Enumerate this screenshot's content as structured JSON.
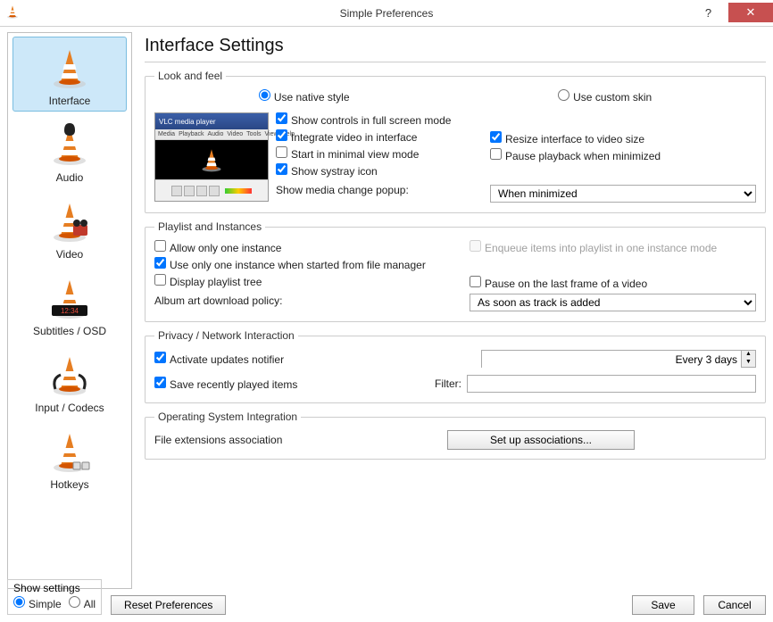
{
  "window": {
    "title": "Simple Preferences"
  },
  "sidebar": {
    "items": [
      {
        "label": "Interface"
      },
      {
        "label": "Audio"
      },
      {
        "label": "Video"
      },
      {
        "label": "Subtitles / OSD"
      },
      {
        "label": "Input / Codecs"
      },
      {
        "label": "Hotkeys"
      }
    ]
  },
  "main": {
    "heading": "Interface Settings",
    "look": {
      "legend": "Look and feel",
      "native": "Use native style",
      "custom": "Use custom skin",
      "show_controls": "Show controls in full screen mode",
      "integrate_video": "Integrate video in interface",
      "resize_interface": "Resize interface to video size",
      "start_minimal": "Start in minimal view mode",
      "pause_minimized": "Pause playback when minimized",
      "show_systray": "Show systray icon",
      "media_popup_label": "Show media change popup:",
      "media_popup_value": "When minimized",
      "preview_title": "VLC media player",
      "preview_menu": [
        "Media",
        "Playback",
        "Audio",
        "Video",
        "Tools",
        "View",
        "Help"
      ]
    },
    "playlist": {
      "legend": "Playlist and Instances",
      "one_instance": "Allow only one instance",
      "enqueue": "Enqueue items into playlist in one instance mode",
      "one_from_fm": "Use only one instance when started from file manager",
      "display_tree": "Display playlist tree",
      "pause_last": "Pause on the last frame of a video",
      "album_label": "Album art download policy:",
      "album_value": "As soon as track is added"
    },
    "privacy": {
      "legend": "Privacy / Network Interaction",
      "updates": "Activate updates notifier",
      "updates_value": "Every 3 days",
      "save_recent": "Save recently played items",
      "filter_label": "Filter:"
    },
    "os": {
      "legend": "Operating System Integration",
      "assoc_label": "File extensions association",
      "assoc_button": "Set up associations..."
    }
  },
  "footer": {
    "show_label": "Show settings",
    "simple": "Simple",
    "all": "All",
    "reset": "Reset Preferences",
    "save": "Save",
    "cancel": "Cancel"
  }
}
